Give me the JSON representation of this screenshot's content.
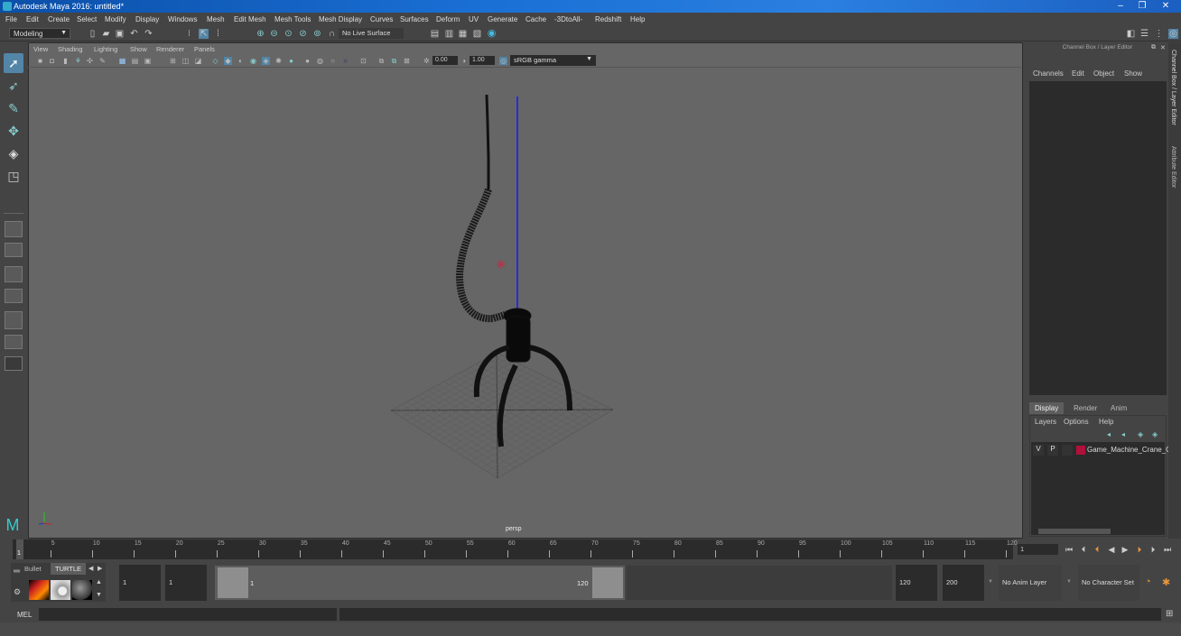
{
  "window": {
    "title": "Autodesk Maya 2016: untitled*",
    "minimize": "–",
    "restore": "❐",
    "close": "✕"
  },
  "menubar": [
    "File",
    "Edit",
    "Create",
    "Select",
    "Modify",
    "Display",
    "Windows",
    "Mesh",
    "Edit Mesh",
    "Mesh Tools",
    "Mesh Display",
    "Curves",
    "Surfaces",
    "Deform",
    "UV",
    "Generate",
    "Cache",
    "-3DtoAll-",
    "Redshift",
    "Help"
  ],
  "toolbar": {
    "mode": "Modeling",
    "live_surface": "No Live Surface",
    "icons": [
      "new-scene-icon",
      "open-scene-icon",
      "save-scene-icon",
      "undo-icon",
      "redo-icon",
      "select-hierarchy-icon",
      "select-object-icon",
      "select-component-icon",
      "snap-grid-icon",
      "snap-curve-icon",
      "snap-point-icon",
      "snap-view-plane-icon",
      "snap-live-icon",
      "magnet-icon",
      "render-frame-icon",
      "render-icon",
      "ipr-render-icon",
      "render-settings-icon",
      "hypershade-icon"
    ],
    "right_icons": [
      "modeling-toolkit-icon",
      "attribute-editor-icon",
      "tool-settings-icon",
      "channel-box-icon"
    ]
  },
  "left_tools": [
    "select-tool-icon",
    "lasso-tool-icon",
    "paint-select-icon",
    "move-tool-icon",
    "rotate-tool-icon",
    "scale-tool-icon"
  ],
  "layouts": [
    "single-pane-layout-icon",
    "four-pane-layout-icon",
    "two-pane-side-layout-icon",
    "two-pane-stacked-layout-icon",
    "outliner-persp-layout-icon",
    "persp-graph-layout-icon",
    "custom-layout-icon"
  ],
  "viewport": {
    "menus": [
      "View",
      "Shading",
      "Lighting",
      "Show",
      "Renderer",
      "Panels"
    ],
    "exposure": "0.00",
    "gamma": "1.00",
    "color_space": "sRGB gamma",
    "camera": "persp",
    "object": "Game_Machine_Crane"
  },
  "channel_box": {
    "title": "Channel Box / Layer Editor",
    "menus": [
      "Channels",
      "Edit",
      "Object",
      "Show"
    ]
  },
  "layer_editor": {
    "tabs": [
      "Display",
      "Render",
      "Anim"
    ],
    "active_tab": "Display",
    "menus": [
      "Layers",
      "Options",
      "Help"
    ],
    "layers": [
      {
        "v": "V",
        "p": "P",
        "color": "#b0103a",
        "name": "Game_Machine_Crane_C"
      }
    ]
  },
  "side_tabs": [
    "Channel Box / Layer Editor",
    "Attribute Editor"
  ],
  "timeline": {
    "ticks": [
      5,
      10,
      15,
      20,
      25,
      30,
      35,
      40,
      45,
      50,
      55,
      60,
      65,
      70,
      75,
      80,
      85,
      90,
      95,
      100,
      105,
      110,
      115,
      120
    ],
    "current_frame": "1",
    "start_marker": "1"
  },
  "playback": [
    "go-to-start-icon",
    "step-back-key-icon",
    "step-back-frame-icon",
    "play-backward-icon",
    "play-forward-icon",
    "step-forward-frame-icon",
    "step-forward-key-icon",
    "go-to-end-icon"
  ],
  "range": {
    "start": "1",
    "playback_start": "1",
    "slider_start": "1",
    "slider_end": "120",
    "playback_end": "120",
    "end": "200",
    "anim_layer": "No Anim Layer",
    "character_set": "No Character Set"
  },
  "shelf": {
    "tabs": [
      "Bullet",
      "TURTLE"
    ],
    "active_tab": "TURTLE"
  },
  "mel": {
    "label": "MEL"
  }
}
